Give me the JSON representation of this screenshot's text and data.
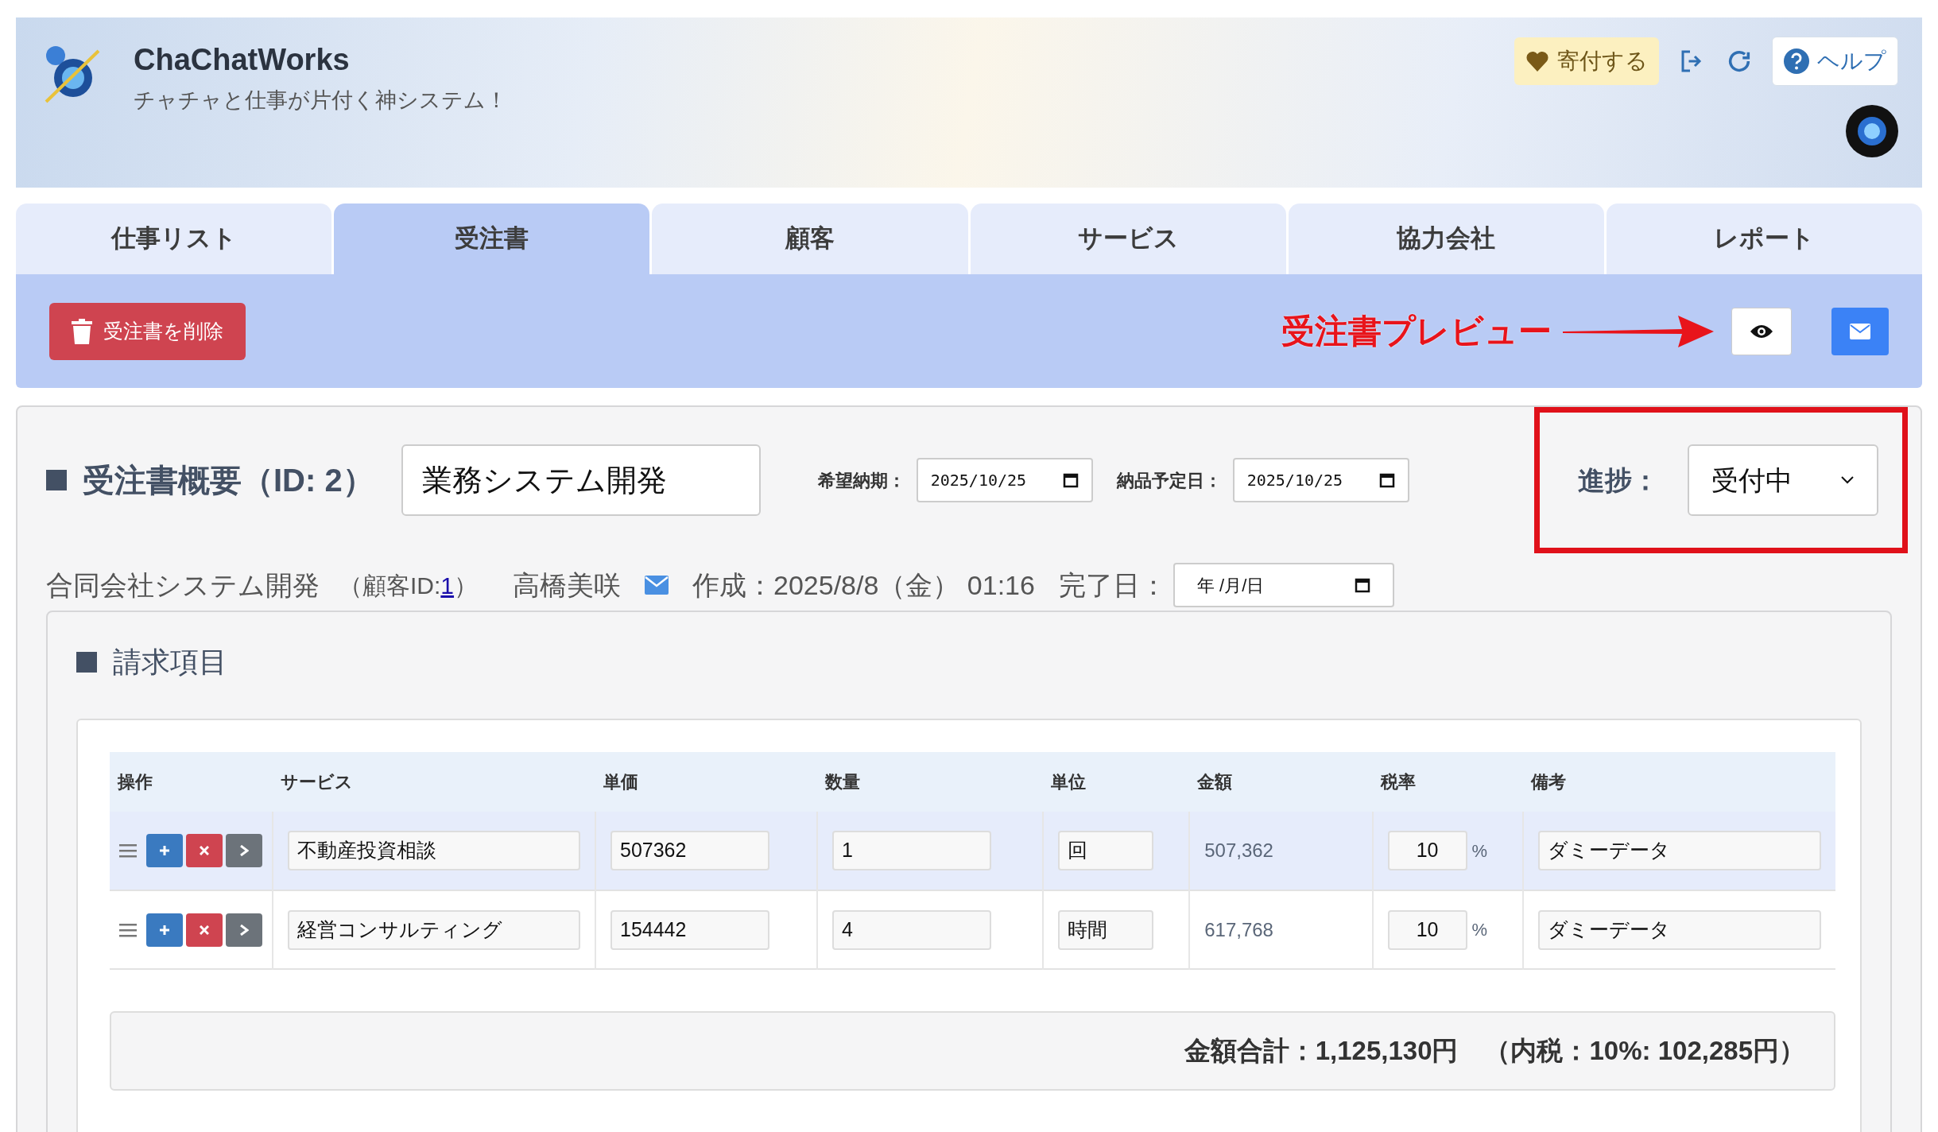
{
  "app": {
    "title": "ChaChatWorks",
    "subtitle": "チャチャと仕事が片付く神システム！"
  },
  "header_actions": {
    "donate": "寄付する",
    "help": "ヘルプ"
  },
  "tabs": [
    {
      "label": "仕事リスト",
      "selected": false
    },
    {
      "label": "受注書",
      "selected": true
    },
    {
      "label": "顧客",
      "selected": false
    },
    {
      "label": "サービス",
      "selected": false
    },
    {
      "label": "協力会社",
      "selected": false
    },
    {
      "label": "レポート",
      "selected": false
    }
  ],
  "toolbar": {
    "delete_button": "受注書を削除",
    "annotation": "受注書プレビュー"
  },
  "order": {
    "title": "受注書概要（ID: 2）",
    "name": "業務システム開発",
    "desired_date_label": "希望納期：",
    "desired_date": "2025/10/25",
    "delivery_date_label": "納品予定日：",
    "delivery_date": "2025/10/25",
    "progress_label": "進捗：",
    "progress": "受付中",
    "customer": "合同会社システム開発",
    "customer_id": {
      "before": "（顧客ID: ",
      "link": "1",
      "after": "）"
    },
    "contact": "高橋美咲",
    "created": "作成：2025/8/8（金） 01:16",
    "completed_label": "完了日：",
    "completed_placeholder": "年 /月/日"
  },
  "billing": {
    "title": "請求項目",
    "columns": [
      "操作",
      "サービス",
      "単価",
      "数量",
      "単位",
      "金額",
      "税率",
      "備考"
    ],
    "rows": [
      {
        "highlighted": true,
        "service": "不動産投資相談",
        "unit_price": "507362",
        "quantity": "1",
        "unit": "回",
        "amount": "507,362",
        "tax_rate": "10",
        "percent": "%",
        "note": "ダミーデータ"
      },
      {
        "highlighted": false,
        "service": "経営コンサルティング",
        "unit_price": "154442",
        "quantity": "4",
        "unit": "時間",
        "amount": "617,768",
        "tax_rate": "10",
        "percent": "%",
        "note": "ダミーデータ"
      }
    ],
    "total": "金額合計：1,125,130円　（内税：10%: 102,285円）"
  }
}
